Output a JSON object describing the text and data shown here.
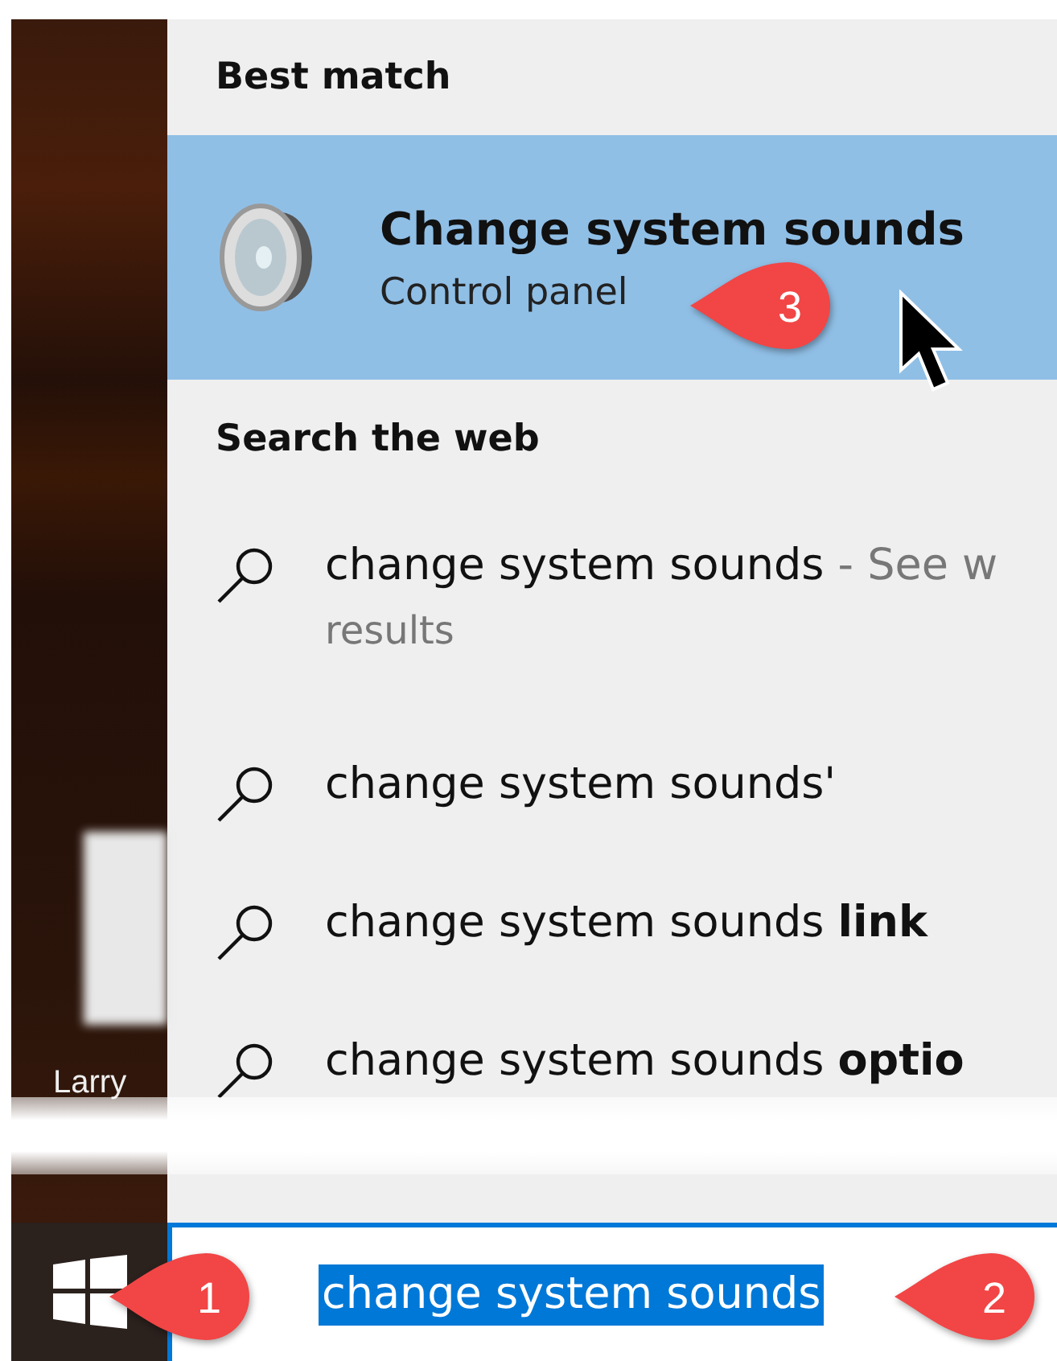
{
  "desktop": {
    "icon_label": "Larry"
  },
  "search_results": {
    "best_match_heading": "Best match",
    "best_match": {
      "title": "Change system sounds",
      "subtitle": "Control panel",
      "selected": true,
      "callout": "3"
    },
    "web_heading": "Search the web",
    "web_results": [
      {
        "text": "change system sounds",
        "hint": "- See w",
        "hint_continued": "results"
      },
      {
        "text": "change system sounds'"
      },
      {
        "text": "change system sounds **link**"
      },
      {
        "text": "change system sounds **optio**"
      }
    ]
  },
  "taskbar": {
    "start_callout": "1"
  },
  "search_box": {
    "value": "change system sounds",
    "text_selected": true,
    "callout": "2"
  }
}
